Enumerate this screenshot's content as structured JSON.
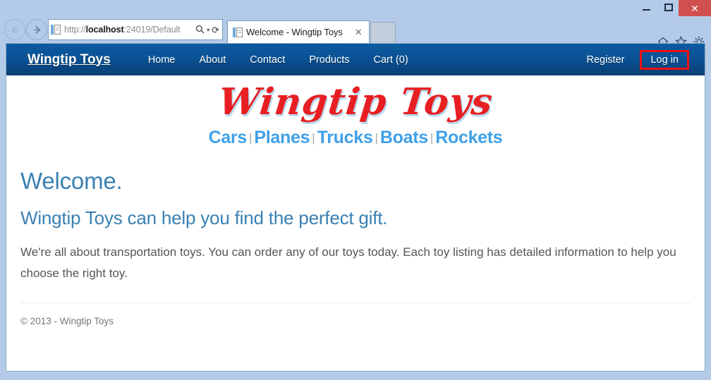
{
  "window": {
    "minimize_label": "Minimize",
    "maximize_label": "Maximize",
    "close_label": "✕"
  },
  "browser": {
    "back_label": "⬅",
    "forward_label": "➡",
    "address": {
      "scheme": "http://",
      "host": "localhost",
      "path": ":24019/Default",
      "search_icon": "search-icon",
      "dropdown_caret": "▾",
      "refresh_icon": "⟳"
    },
    "tab": {
      "title": "Welcome - Wingtip Toys",
      "close_label": "✕"
    },
    "new_tab_label": "",
    "toolbar_icons": [
      {
        "name": "home-icon",
        "glyph": "⌂"
      },
      {
        "name": "favorites-icon",
        "glyph": "★"
      },
      {
        "name": "settings-icon",
        "glyph": "⚙"
      }
    ]
  },
  "site": {
    "navbar": {
      "brand": "Wingtip Toys",
      "links": [
        {
          "label": "Home"
        },
        {
          "label": "About"
        },
        {
          "label": "Contact"
        },
        {
          "label": "Products"
        },
        {
          "label": "Cart (0)"
        }
      ],
      "register_label": "Register",
      "login_label": "Log in",
      "highlight_color": "#ee1111",
      "background_top": "#0b5ba0",
      "background_bottom": "#083f74"
    },
    "logo": {
      "text": "Wingtip Toys",
      "color": "#e81f22",
      "shadow_color": "#b9dcf2"
    },
    "categories": {
      "separator": "|",
      "color": "#3fa0e8",
      "items": [
        {
          "label": "Cars"
        },
        {
          "label": "Planes"
        },
        {
          "label": "Trucks"
        },
        {
          "label": "Boats"
        },
        {
          "label": "Rockets"
        }
      ]
    },
    "main": {
      "heading": "Welcome.",
      "subheading": "Wingtip Toys can help you find the perfect gift.",
      "paragraph": "We're all about transportation toys. You can order any of our toys today. Each toy listing has detailed information to help you choose the right toy.",
      "heading_color": "#3a80b3"
    },
    "footer": {
      "copyright": "© 2013 - Wingtip Toys"
    }
  }
}
